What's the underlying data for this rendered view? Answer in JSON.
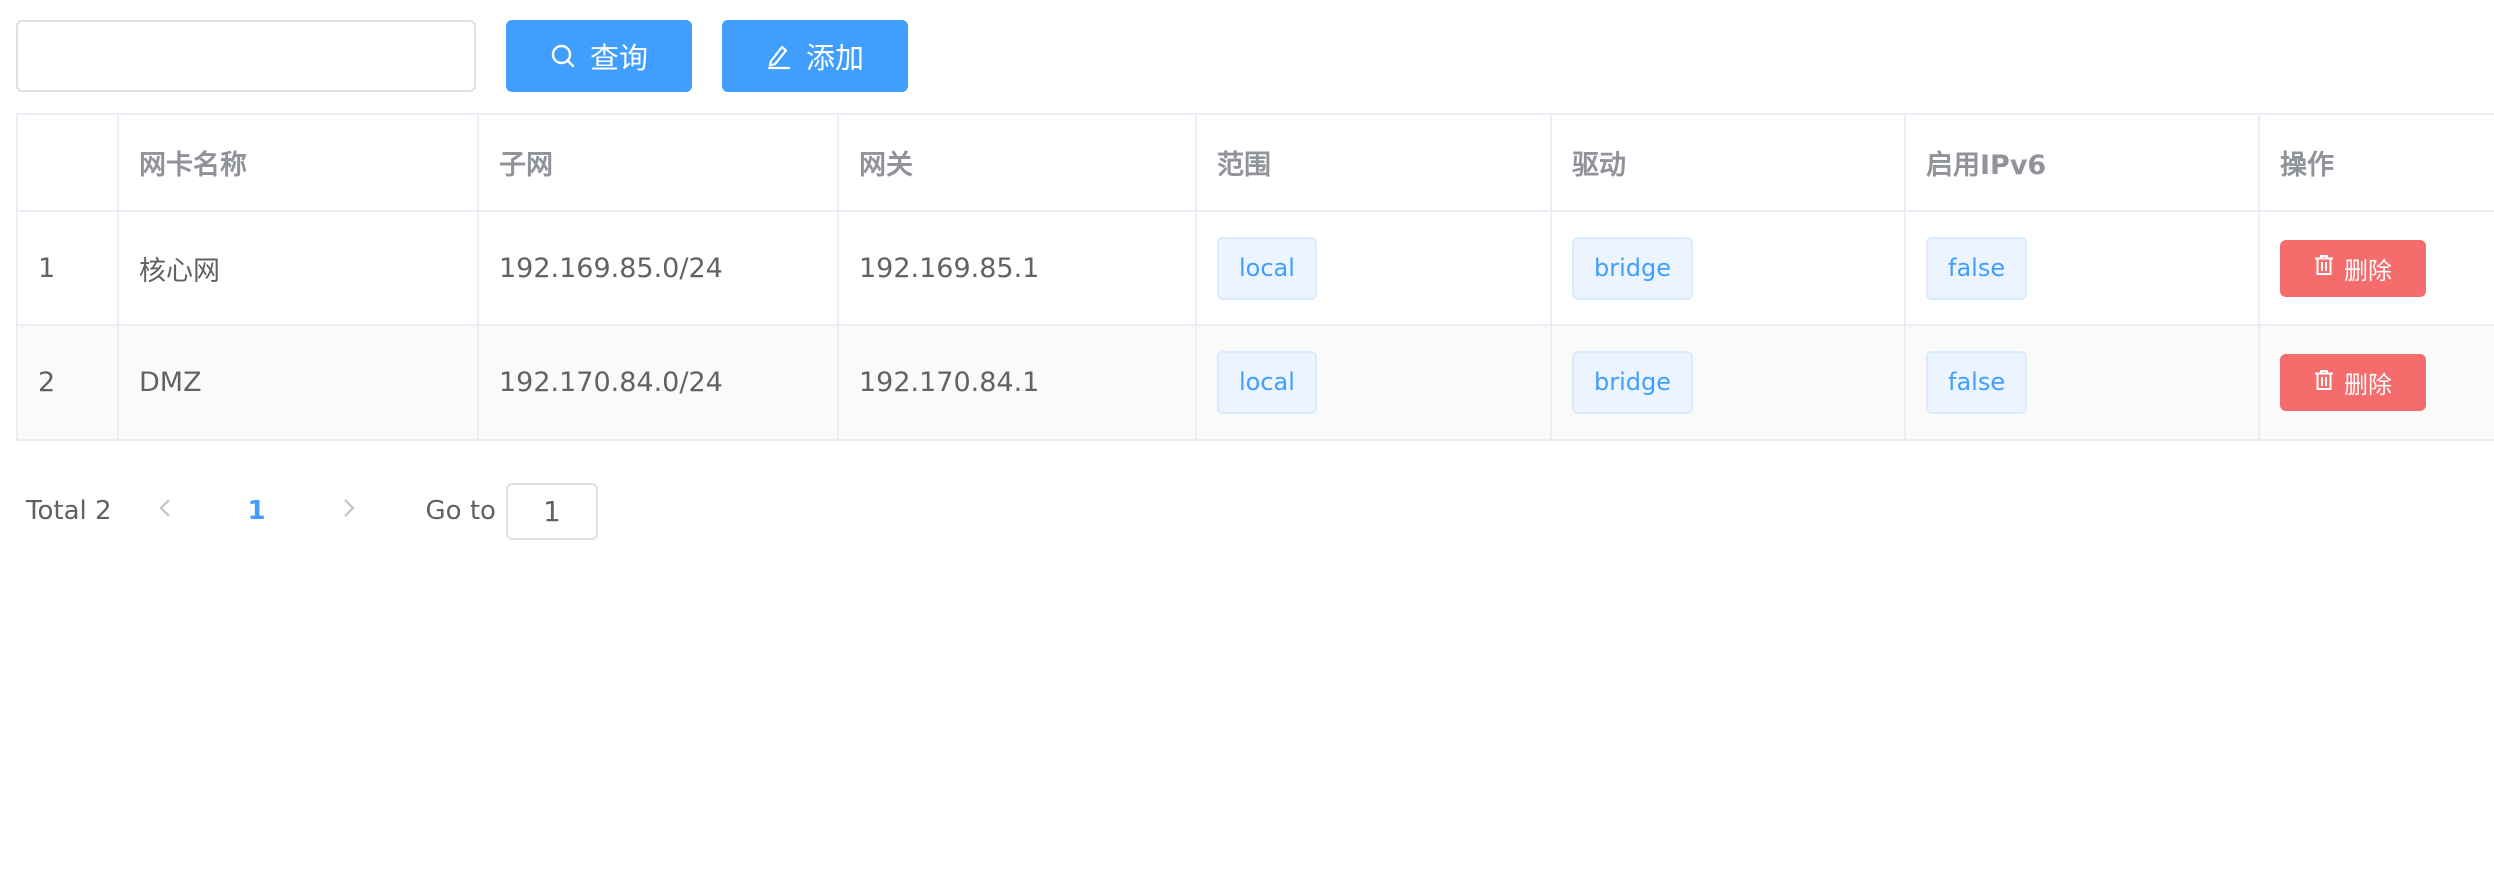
{
  "toolbar": {
    "search_value": "",
    "search_placeholder": "",
    "search_button_label": "查询",
    "add_button_label": "添加"
  },
  "table": {
    "columns": [
      "",
      "网卡名称",
      "子网",
      "网关",
      "范围",
      "驱动",
      "启用IPv6",
      "操作"
    ],
    "rows": [
      {
        "index": "1",
        "name": "核心网",
        "subnet": "192.169.85.0/24",
        "gateway": "192.169.85.1",
        "scope": "local",
        "driver": "bridge",
        "ipv6": "false",
        "action": "删除"
      },
      {
        "index": "2",
        "name": "DMZ",
        "subnet": "192.170.84.0/24",
        "gateway": "192.170.84.1",
        "scope": "local",
        "driver": "bridge",
        "ipv6": "false",
        "action": "删除"
      }
    ]
  },
  "pagination": {
    "total_label": "Total 2",
    "current_page": "1",
    "goto_label": "Go to",
    "goto_value": "1"
  },
  "colors": {
    "primary": "#409eff",
    "danger": "#f56c6c",
    "tag_bg": "#ecf5ff",
    "border": "#ebeef5"
  },
  "icons": {
    "search": "search-icon",
    "add": "edit-pen-icon",
    "delete": "trash-icon",
    "prev": "chevron-left-icon",
    "next": "chevron-right-icon"
  }
}
